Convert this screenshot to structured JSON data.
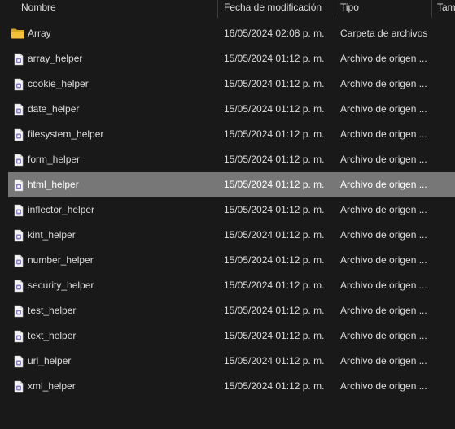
{
  "header": {
    "name": "Nombre",
    "date": "Fecha de modificación",
    "type": "Tipo",
    "size": "Tam"
  },
  "rows": [
    {
      "name": "Array",
      "date": "16/05/2024 02:08 p. m.",
      "type": "Carpeta de archivos",
      "icon": "folder-icon"
    },
    {
      "name": "array_helper",
      "date": "15/05/2024 01:12 p. m.",
      "type": "Archivo de origen ...",
      "icon": "php-file-icon"
    },
    {
      "name": "cookie_helper",
      "date": "15/05/2024 01:12 p. m.",
      "type": "Archivo de origen ...",
      "icon": "php-file-icon"
    },
    {
      "name": "date_helper",
      "date": "15/05/2024 01:12 p. m.",
      "type": "Archivo de origen ...",
      "icon": "php-file-icon"
    },
    {
      "name": "filesystem_helper",
      "date": "15/05/2024 01:12 p. m.",
      "type": "Archivo de origen ...",
      "icon": "php-file-icon"
    },
    {
      "name": "form_helper",
      "date": "15/05/2024 01:12 p. m.",
      "type": "Archivo de origen ...",
      "icon": "php-file-icon"
    },
    {
      "name": "html_helper",
      "date": "15/05/2024 01:12 p. m.",
      "type": "Archivo de origen ...",
      "icon": "php-file-icon",
      "selected": true
    },
    {
      "name": "inflector_helper",
      "date": "15/05/2024 01:12 p. m.",
      "type": "Archivo de origen ...",
      "icon": "php-file-icon"
    },
    {
      "name": "kint_helper",
      "date": "15/05/2024 01:12 p. m.",
      "type": "Archivo de origen ...",
      "icon": "php-file-icon"
    },
    {
      "name": "number_helper",
      "date": "15/05/2024 01:12 p. m.",
      "type": "Archivo de origen ...",
      "icon": "php-file-icon"
    },
    {
      "name": "security_helper",
      "date": "15/05/2024 01:12 p. m.",
      "type": "Archivo de origen ...",
      "icon": "php-file-icon"
    },
    {
      "name": "test_helper",
      "date": "15/05/2024 01:12 p. m.",
      "type": "Archivo de origen ...",
      "icon": "php-file-icon"
    },
    {
      "name": "text_helper",
      "date": "15/05/2024 01:12 p. m.",
      "type": "Archivo de origen ...",
      "icon": "php-file-icon"
    },
    {
      "name": "url_helper",
      "date": "15/05/2024 01:12 p. m.",
      "type": "Archivo de origen ...",
      "icon": "php-file-icon"
    },
    {
      "name": "xml_helper",
      "date": "15/05/2024 01:12 p. m.",
      "type": "Archivo de origen ...",
      "icon": "php-file-icon"
    }
  ],
  "colors": {
    "background": "#191919",
    "text": "#dcdcdc",
    "selection": "#777777",
    "folder": "#f3c13a",
    "php_accent": "#8a7cc8"
  }
}
